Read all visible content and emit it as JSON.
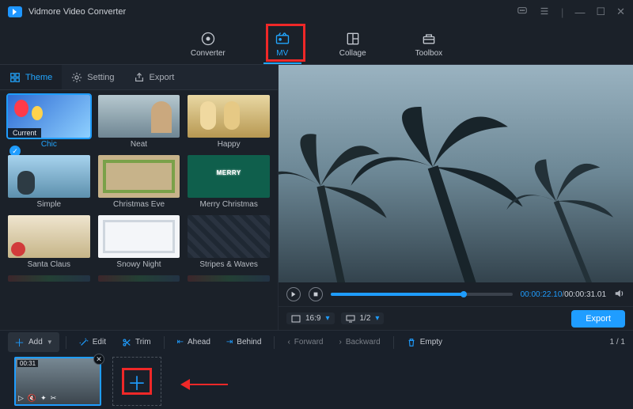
{
  "app": {
    "title": "Vidmore Video Converter"
  },
  "window_controls": {
    "feedback_icon": "feedback",
    "menu_icon": "menu",
    "minimize_icon": "minimize",
    "maximize_icon": "maximize",
    "close_icon": "close"
  },
  "top_nav": {
    "items": [
      {
        "key": "converter",
        "label": "Converter",
        "active": false
      },
      {
        "key": "mv",
        "label": "MV",
        "active": true
      },
      {
        "key": "collage",
        "label": "Collage",
        "active": false
      },
      {
        "key": "toolbox",
        "label": "Toolbox",
        "active": false
      }
    ]
  },
  "left_tabs": {
    "items": [
      {
        "key": "theme",
        "label": "Theme",
        "active": true
      },
      {
        "key": "setting",
        "label": "Setting",
        "active": false
      },
      {
        "key": "export",
        "label": "Export",
        "active": false
      }
    ]
  },
  "themes": {
    "items": [
      {
        "name": "Chic",
        "selected": true,
        "current_tag": "Current"
      },
      {
        "name": "Neat"
      },
      {
        "name": "Happy"
      },
      {
        "name": "Simple"
      },
      {
        "name": "Christmas Eve"
      },
      {
        "name": "Merry Christmas",
        "overlay_text": "MERRY"
      },
      {
        "name": "Santa Claus"
      },
      {
        "name": "Snowy Night"
      },
      {
        "name": "Stripes & Waves"
      }
    ]
  },
  "preview": {
    "current_time": "00:00:22.10",
    "total_time": "00:00:31.01",
    "progress_pct": 73,
    "aspect_ratio": "16:9",
    "zoom": "1/2",
    "export_label": "Export"
  },
  "action_bar": {
    "add": "Add",
    "edit": "Edit",
    "trim": "Trim",
    "ahead": "Ahead",
    "behind": "Behind",
    "forward": "Forward",
    "backward": "Backward",
    "empty": "Empty",
    "pager": "1 / 1"
  },
  "timeline": {
    "clip": {
      "duration": "00:31"
    }
  },
  "colors": {
    "accent": "#1f9dff",
    "annotation": "#ef2828",
    "panel": "#1b2129"
  }
}
